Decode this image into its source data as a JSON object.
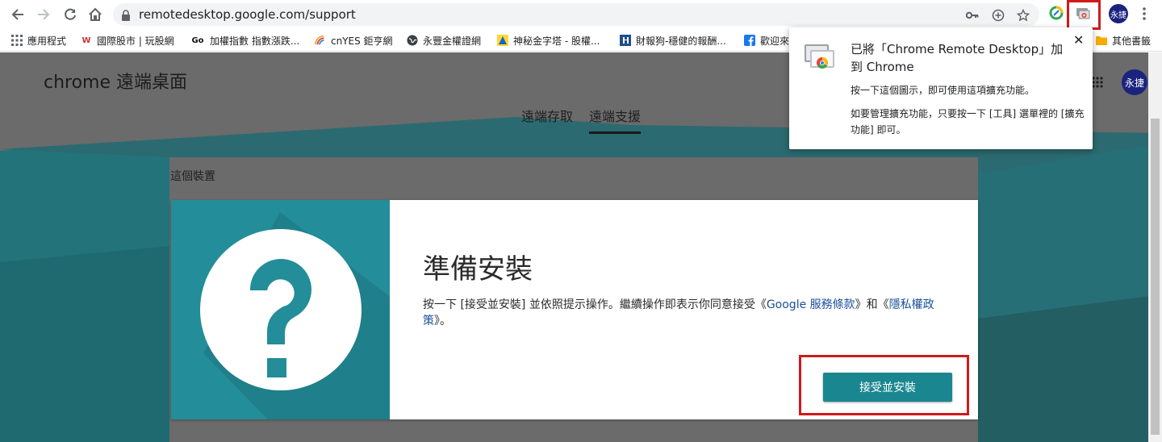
{
  "browser": {
    "url": "remotedesktop.google.com/support",
    "profile_initials": "永捷"
  },
  "bookmarks": [
    {
      "label": "應用程式",
      "icon": "apps-grid-icon"
    },
    {
      "label": "國際股市 | 玩股網",
      "icon": "w-logo-icon"
    },
    {
      "label": "加權指數 指數漲跌...",
      "icon": "go-logo-icon"
    },
    {
      "label": "cnYES 鉅亨網",
      "icon": "cnyes-logo-icon"
    },
    {
      "label": "永豐金權證網",
      "icon": "globe-icon"
    },
    {
      "label": "神秘金字塔 - 股權...",
      "icon": "pyramid-icon"
    },
    {
      "label": "財報狗-穩健的報酬...",
      "icon": "dog-icon"
    },
    {
      "label": "歡迎來",
      "icon": "facebook-icon"
    },
    {
      "label": "其他書籤",
      "icon": "folder-icon"
    }
  ],
  "page": {
    "app_title": "chrome 遠端桌面",
    "tabs": [
      "遠端存取",
      "遠端支援"
    ],
    "active_tab": "遠端支援",
    "profile_initials": "永捷",
    "section_label": "這個裝置",
    "card": {
      "title": "準備安裝",
      "desc_prefix": "按一下 [接受並安裝] 並依照提示操作。繼續操作即表示你同意接受《",
      "terms_link": "Google 服務條款",
      "desc_mid": "》和《",
      "privacy_link": "隱私權政策",
      "desc_suffix": "》。",
      "button_label": "接受並安裝"
    }
  },
  "popup": {
    "title": "已將「Chrome Remote Desktop」加到 Chrome",
    "line1": "按一下這個圖示，即可使用這項擴充功能。",
    "line2": "如要管理擴充功能，只要按一下 [工具] 選單裡的 [擴充功能] 即可。",
    "close": "✕"
  },
  "colors": {
    "teal": "#238d99",
    "button": "#1a8790",
    "highlight": "#d01a1a",
    "link": "#1a4f9c"
  }
}
